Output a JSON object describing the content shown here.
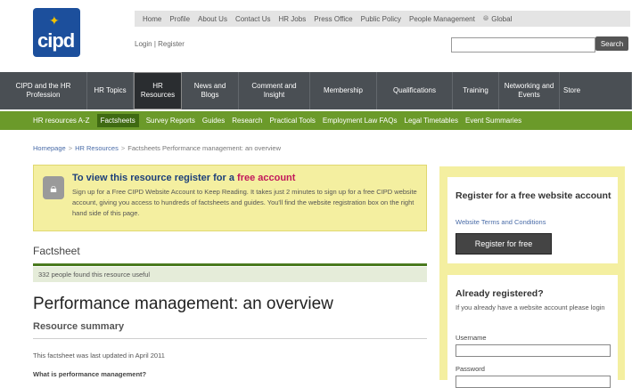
{
  "logo": {
    "text": "cipd",
    "mark": "✦"
  },
  "topnav": [
    "Home",
    "Profile",
    "About Us",
    "Contact Us",
    "HR Jobs",
    "Press Office",
    "Public Policy",
    "People Management",
    "Global"
  ],
  "login": {
    "login": "Login",
    "sep": "|",
    "register": "Register"
  },
  "search": {
    "button": "Search",
    "value": ""
  },
  "mainnav": [
    {
      "label": "CIPD and the HR Profession",
      "active": false
    },
    {
      "label": "HR Topics",
      "active": false
    },
    {
      "label": "HR Resources",
      "active": true
    },
    {
      "label": "News and Blogs",
      "active": false
    },
    {
      "label": "Comment and Insight",
      "active": false
    },
    {
      "label": "Membership",
      "active": false
    },
    {
      "label": "Qualifications",
      "active": false
    },
    {
      "label": "Training",
      "active": false
    },
    {
      "label": "Networking and Events",
      "active": false
    },
    {
      "label": "Store",
      "active": false
    }
  ],
  "subnav": [
    "HR resources A-Z",
    "Factsheets",
    "Survey Reports",
    "Guides",
    "Research",
    "Practical Tools",
    "Employment Law FAQs",
    "Legal Timetables",
    "Event Summaries"
  ],
  "subnav_active": "Factsheets",
  "breadcrumb": {
    "home": "Homepage",
    "resources": "HR Resources",
    "current": "Factsheets Performance management: an overview"
  },
  "promo": {
    "title_pre": "To view this resource register for a ",
    "title_free": "free account",
    "body": "Sign up for a Free CIPD Website Account to Keep Reading. It takes just 2 minutes to sign up for a free CIPD website account, giving you access to hundreds of factsheets and guides. You'll find the website registration box on the right hand side of this page."
  },
  "article": {
    "label": "Factsheet",
    "found": "332 people found this resource useful",
    "title": "Performance management: an overview",
    "summary": "Resource summary",
    "updated": "This factsheet was last updated in April 2011",
    "question": "What is performance management?"
  },
  "register_box": {
    "title": "Register for a free website account",
    "terms": "Website Terms and Conditions",
    "button": "Register for free"
  },
  "login_box": {
    "title": "Already registered?",
    "text": "If you already have a website account please login",
    "username_label": "Username",
    "password_label": "Password"
  },
  "colors": {
    "brand_blue": "#1c4f9c",
    "nav_dark": "#4a4f54",
    "nav_green": "#6b9a2a",
    "promo_yellow": "#f4efa0",
    "link": "#4a6ca8",
    "free_pink": "#c2185b"
  }
}
